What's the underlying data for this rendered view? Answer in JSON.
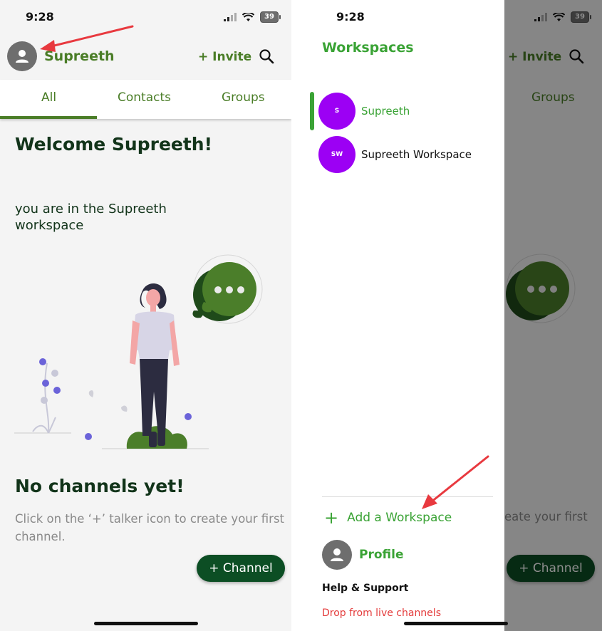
{
  "colors": {
    "brand_green": "#4a7d27",
    "dark_green": "#0c4e24",
    "drawer_green": "#3aa335",
    "workspace_purple": "#9c00f4",
    "danger_red": "#e43b3b",
    "arrow_red": "#e8393f"
  },
  "left": {
    "status": {
      "time": "9:28",
      "battery": "39"
    },
    "header": {
      "workspace_name": "Supreeth",
      "invite_label": "+ Invite",
      "search_icon": "search-icon"
    },
    "tabs": [
      {
        "label": "All"
      },
      {
        "label": "Contacts"
      },
      {
        "label": "Groups"
      }
    ],
    "welcome": "Welcome Supreeth!",
    "workspace_line": "you are in the Supreeth\n workspace",
    "empty_title": "No channels yet!",
    "empty_hint": "Click on the ‘+’ talker icon to create your first channel.",
    "channel_button": "+ Channel"
  },
  "right": {
    "status": {
      "time": "9:28",
      "battery": "39"
    },
    "background": {
      "invite_label": "+ Invite",
      "groups_tab": "Groups",
      "hint_fragment": "eate your first",
      "channel_button": "+ Channel"
    },
    "drawer": {
      "title": "Workspaces",
      "workspaces": [
        {
          "initials": "S",
          "name": "Supreeth",
          "active": true
        },
        {
          "initials": "SW",
          "name": "Supreeth Workspace",
          "active": false
        }
      ],
      "add_workspace": "Add a Workspace",
      "profile": "Profile",
      "help": "Help & Support",
      "drop": "Drop from live channels"
    }
  }
}
